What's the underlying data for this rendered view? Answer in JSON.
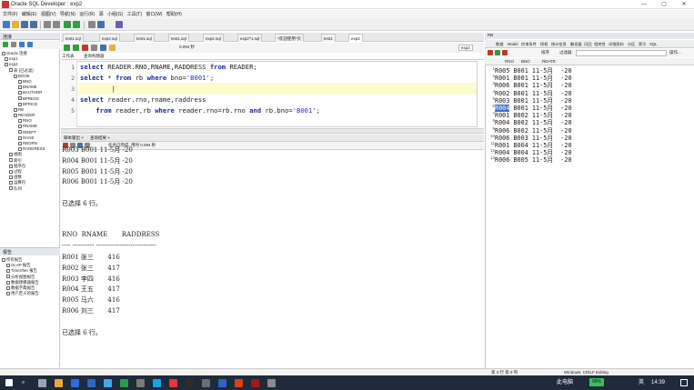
{
  "window": {
    "title": "Oracle SQL Developer : exp2",
    "buttons": [
      "—",
      "▢",
      "✕"
    ]
  },
  "menu": [
    "文件(F)",
    "编辑(E)",
    "视图(V)",
    "导航(N)",
    "运行(R)",
    "源",
    "小组(G)",
    "工具(T)",
    "窗口(W)",
    "帮助(H)"
  ],
  "connections": {
    "header": "连接",
    "root": "Oracle 连接",
    "items": [
      "exp1",
      "exp2",
      "表 (已过滤)",
      "BOOK",
      "BNO",
      "BNAME",
      "BAUTHOR",
      "BPRESS",
      "BPRICE",
      "RB",
      "READER",
      "RNO",
      "RNAME",
      "RDEPT",
      "RAGE",
      "RBORN",
      "RADDRESS",
      "视图",
      "索引",
      "程序包",
      "过程",
      "函数",
      "运算符",
      "队列"
    ]
  },
  "reports": {
    "header": "报告",
    "items": [
      "所有报告",
      "OLAP 报告",
      "TimesTen 报告",
      "分析视图报告",
      "数据建模器报告",
      "数据字典报告",
      "用户定义的报告"
    ]
  },
  "editor": {
    "tabs": [
      "test1.sql",
      "exp2.sql",
      "test1.sql",
      "test1.sql",
      "exp2.sql",
      "exp2^1.sql",
      "*欢迎使用*页",
      "test1",
      "exp2"
    ],
    "subtabs": [
      "工作表",
      "查询构建器"
    ],
    "timing": "0.094 秒",
    "conn_label": "exp2",
    "lines": [
      {
        "n": "1",
        "tokens": [
          [
            "kw",
            "select"
          ],
          [
            "t",
            " READER.RNO,RNAME,RADDRESS "
          ],
          [
            "kw",
            "from"
          ],
          [
            "t",
            " READER;"
          ]
        ]
      },
      {
        "n": "2",
        "tokens": [
          [
            "kw",
            "select"
          ],
          [
            "t",
            " * "
          ],
          [
            "kw",
            "from"
          ],
          [
            "t",
            " rb "
          ],
          [
            "kw",
            "where"
          ],
          [
            "t",
            " bno="
          ],
          [
            "str",
            "'B001'"
          ],
          [
            "t",
            ";"
          ]
        ]
      },
      {
        "n": "3",
        "tokens": [
          [
            "t",
            "        |"
          ]
        ]
      },
      {
        "n": "4",
        "tokens": [
          [
            "kw",
            "select"
          ],
          [
            "t",
            " reader.rno,rname,raddress"
          ]
        ]
      },
      {
        "n": "5",
        "tokens": [
          [
            "t",
            "    "
          ],
          [
            "kw",
            "from"
          ],
          [
            "t",
            " reader,rb "
          ],
          [
            "kw",
            "where"
          ],
          [
            "t",
            " reader.rno=rb.rno "
          ],
          [
            "kw",
            "and"
          ],
          [
            "t",
            " rb.bno="
          ],
          [
            "str",
            "'B001'"
          ],
          [
            "t",
            ";"
          ]
        ]
      }
    ]
  },
  "output": {
    "header": [
      "脚本输出 ×",
      "查询结果 ×"
    ],
    "status": "任务已完成, 用时 0.094 秒",
    "lines": [
      "R003 B001 11-5月 -20",
      "R004 B001 11-5月 -20",
      "R005 B001 11-5月 -20",
      "R006 B001 11-5月 -20",
      "",
      "已选择 6 行。",
      "",
      "",
      "RNO  RNAME       RADDRESS",
      "---- ---------- ----------------------------",
      "R001 张三       416",
      "R002 张三       417",
      "R003 李四       416",
      "R004 王五       417",
      "R005 马六       416",
      "R006 刘三       417",
      "",
      "已选择 6 行。"
    ]
  },
  "rightpanel": {
    "header": "RB",
    "tabs": [
      "数据",
      "Model",
      "约束条件",
      "授权",
      "统计信息",
      "触发器",
      "闪回",
      "相关性",
      "详细资料",
      "分区",
      "索引",
      "SQL"
    ],
    "filter_label": "过滤器:",
    "sort_label": "排序",
    "actions": "操作...",
    "cols": [
      "RNO",
      "BNO",
      "RDATE"
    ],
    "rows": [
      {
        "n": "1",
        "text": "R005 B001 11-5月  -20"
      },
      {
        "n": "2",
        "text": "R001 B001 11-5月  -20"
      },
      {
        "n": "3",
        "text": "R006 B001 11-5月  -20"
      },
      {
        "n": "4",
        "text": "R002 B001 11-5月  -20"
      },
      {
        "n": "5",
        "text": "R003 B001 11-5月  -20"
      },
      {
        "n": "6",
        "text": "R004 B001 11-5月  -20",
        "selected": "R004"
      },
      {
        "n": "7",
        "text": "R001 B002 11-5月  -20"
      },
      {
        "n": "8",
        "text": "R004 B002 11-5月  -20"
      },
      {
        "n": "9",
        "text": "R006 B002 11-5月  -20"
      },
      {
        "n": "10",
        "text": "R006 B003 11-5月  -20"
      },
      {
        "n": "11",
        "text": "R001 B004 11-5月  -20"
      },
      {
        "n": "12",
        "text": "R004 B004 11-5月  -20"
      },
      {
        "n": "13",
        "text": "R006 B005 11-5月  -20"
      }
    ]
  },
  "status": {
    "text": "第 3 行 第 9 列",
    "mode": "Windows: CR/LF  Editing"
  },
  "taskbar": {
    "search": "⌕",
    "battery": "99%",
    "network": "此电脑",
    "ime": "英",
    "time": "14:39"
  }
}
